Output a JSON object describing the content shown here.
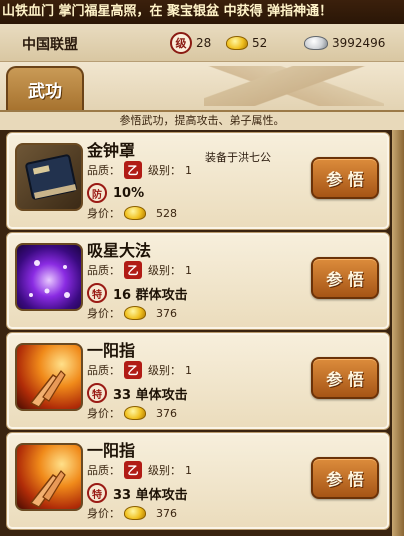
{
  "ticker": "山铁血门 掌门福星高照，在 聚宝银盆 中获得 弹指神通！",
  "header": {
    "alliance": "中国联盟",
    "level_badge": "级",
    "level": "28",
    "gold": "52",
    "silver": "3992496"
  },
  "tabs": [
    {
      "label": "武功"
    }
  ],
  "hint": "参悟武功，提高攻击、弟子属性。",
  "labels": {
    "quality": "品质：",
    "quality_badge": "乙",
    "level": "级别：",
    "price": "身价：",
    "button": "参 悟"
  },
  "skills": [
    {
      "name": "金钟罩",
      "equipped": "装备于洪七公",
      "level": "1",
      "seal": "防",
      "effect": "10%",
      "price": "528",
      "icon": "book-icon"
    },
    {
      "name": "吸星大法",
      "equipped": "",
      "level": "1",
      "seal": "特",
      "effect": "16 群体攻击",
      "price": "376",
      "icon": "vortex-icon"
    },
    {
      "name": "一阳指",
      "equipped": "",
      "level": "1",
      "seal": "特",
      "effect": "33 单体攻击",
      "price": "376",
      "icon": "finger-icon"
    },
    {
      "name": "一阳指",
      "equipped": "",
      "level": "1",
      "seal": "特",
      "effect": "33 单体攻击",
      "price": "376",
      "icon": "finger-icon"
    }
  ],
  "colors": {
    "accent": "#a65516",
    "quality": "#b11c16"
  }
}
